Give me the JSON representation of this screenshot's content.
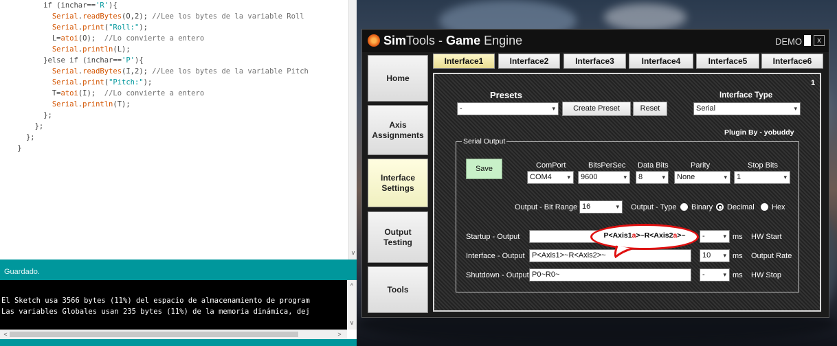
{
  "ide": {
    "code_lines": [
      {
        "indent": 10,
        "parts": [
          [
            "ck",
            "if (inchar=="
          ],
          [
            "cs",
            "'R'"
          ],
          [
            "ck",
            "){"
          ]
        ]
      },
      {
        "indent": 12,
        "parts": [
          [
            "cf",
            "Serial"
          ],
          [
            "ck",
            "."
          ],
          [
            "cf",
            "readBytes"
          ],
          [
            "ck",
            "(O,2); "
          ],
          [
            "cc",
            "//Lee los bytes de la variable Roll"
          ]
        ]
      },
      {
        "indent": 12,
        "parts": [
          [
            "cf",
            "Serial"
          ],
          [
            "ck",
            "."
          ],
          [
            "cf",
            "print"
          ],
          [
            "ck",
            "("
          ],
          [
            "cs",
            "\"Roll:\""
          ],
          [
            "ck",
            ");"
          ]
        ]
      },
      {
        "indent": 12,
        "parts": [
          [
            "ck",
            "L="
          ],
          [
            "cf",
            "atoi"
          ],
          [
            "ck",
            "(O);  "
          ],
          [
            "cc",
            "//Lo convierte a entero"
          ]
        ]
      },
      {
        "indent": 12,
        "parts": [
          [
            "cf",
            "Serial"
          ],
          [
            "ck",
            "."
          ],
          [
            "cf",
            "println"
          ],
          [
            "ck",
            "(L);"
          ]
        ]
      },
      {
        "indent": 10,
        "parts": [
          [
            "ck",
            "}else if (inchar=="
          ],
          [
            "cs",
            "'P'"
          ],
          [
            "ck",
            "){"
          ]
        ]
      },
      {
        "indent": 12,
        "parts": [
          [
            "cf",
            "Serial"
          ],
          [
            "ck",
            "."
          ],
          [
            "cf",
            "readBytes"
          ],
          [
            "ck",
            "(I,2); "
          ],
          [
            "cc",
            "//Lee los bytes de la variable Pitch"
          ]
        ]
      },
      {
        "indent": 12,
        "parts": [
          [
            "cf",
            "Serial"
          ],
          [
            "ck",
            "."
          ],
          [
            "cf",
            "print"
          ],
          [
            "ck",
            "("
          ],
          [
            "cs",
            "\"Pitch:\""
          ],
          [
            "ck",
            ");"
          ]
        ]
      },
      {
        "indent": 12,
        "parts": [
          [
            "ck",
            "T="
          ],
          [
            "cf",
            "atoi"
          ],
          [
            "ck",
            "(I);  "
          ],
          [
            "cc",
            "//Lo convierte a entero"
          ]
        ]
      },
      {
        "indent": 12,
        "parts": [
          [
            "cf",
            "Serial"
          ],
          [
            "ck",
            "."
          ],
          [
            "cf",
            "println"
          ],
          [
            "ck",
            "(T);"
          ]
        ]
      },
      {
        "indent": 10,
        "parts": [
          [
            "ck",
            "};"
          ]
        ]
      },
      {
        "indent": 8,
        "parts": [
          [
            "ck",
            "};"
          ]
        ]
      },
      {
        "indent": 6,
        "parts": [
          [
            "ck",
            "};"
          ]
        ]
      },
      {
        "indent": 4,
        "parts": [
          [
            "ck",
            "}"
          ]
        ]
      }
    ],
    "status": "Guardado.",
    "console_lines": [
      "El Sketch usa 3566 bytes (11%) del espacio de almacenamiento de program",
      "Las variables Globales usan 235 bytes (11%) de la memoria dinámica, dej"
    ]
  },
  "simtools": {
    "title_bold_1": "Sim",
    "title_rest_1": "Tools - ",
    "title_bold_2": "Game",
    "title_rest_2": " Engine",
    "demo": "DEMO",
    "close": "x",
    "nav": [
      "Home",
      "Axis\nAssignments",
      "Interface\nSettings",
      "Output\nTesting",
      "Tools"
    ],
    "tabs": [
      "Interface1",
      "Interface2",
      "Interface3",
      "Interface4",
      "Interface5",
      "Interface6"
    ],
    "panel_number": "1",
    "presets_label": "Presets",
    "preset_value": "-",
    "create_preset": "Create Preset",
    "reset": "Reset",
    "interface_type_label": "Interface Type",
    "interface_type_value": "Serial",
    "plugin_by": "Plugin By - yobuddy",
    "serial_output_label": "Serial Output",
    "save": "Save",
    "comport_label": "ComPort",
    "comport_value": "COM4",
    "bps_label": "BitsPerSec",
    "bps_value": "9600",
    "databits_label": "Data Bits",
    "databits_value": "8",
    "parity_label": "Parity",
    "parity_value": "None",
    "stopbits_label": "Stop Bits",
    "stopbits_value": "1",
    "bitrange_label": "Output - Bit Range",
    "bitrange_value": "16",
    "outtype_label": "Output - Type",
    "binary": "Binary",
    "decimal": "Decimal",
    "hex": "Hex",
    "startup_label": "Startup - Output",
    "startup_value": "",
    "startup_ms_value": "-",
    "hw_start": "HW Start",
    "interface_out_label": "Interface - Output",
    "interface_out_value": "P<Axis1>~R<Axis2>~",
    "rate_value": "10",
    "output_rate": "Output Rate",
    "shutdown_label": "Shutdown - Output",
    "shutdown_value": "P0~R0~",
    "shutdown_ms_value": "-",
    "hw_stop": "HW Stop",
    "ms": "ms",
    "annotation_pre": "P<Axis1",
    "annotation_red1": "a",
    "annotation_mid": ">~R<Axis2",
    "annotation_red2": "a",
    "annotation_post": ">~"
  },
  "icons": {
    "dropdown": "▾",
    "scroll_up": "^",
    "scroll_down": "v",
    "scroll_left": "<",
    "scroll_right": ">"
  }
}
